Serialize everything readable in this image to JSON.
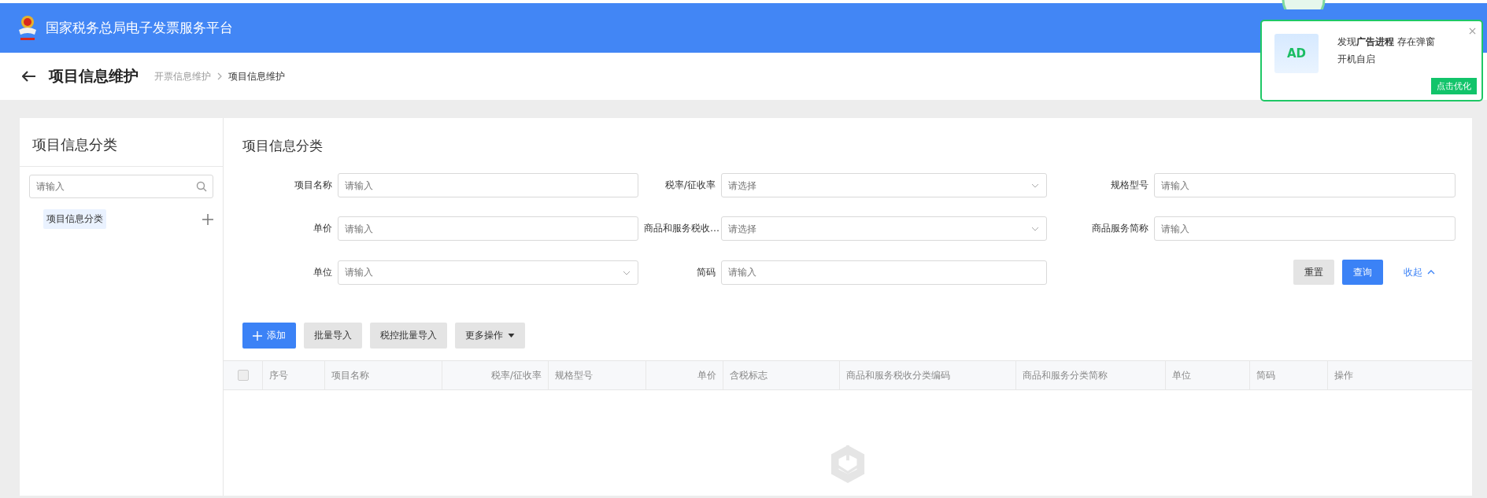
{
  "header": {
    "title": "国家税务总局电子发票服务平台"
  },
  "page": {
    "title": "项目信息维护",
    "breadcrumb": [
      {
        "label": "开票信息维护",
        "current": false
      },
      {
        "label": "项目信息维护",
        "current": true
      }
    ]
  },
  "sidebar": {
    "title": "项目信息分类",
    "search": {
      "placeholder": "请输入"
    },
    "tree": [
      {
        "label": "项目信息分类",
        "selected": true
      }
    ]
  },
  "main": {
    "title": "项目信息分类",
    "filters": [
      {
        "label": "项目名称",
        "placeholder": "请输入",
        "kind": "input"
      },
      {
        "label": "税率/征收率",
        "placeholder": "请选择",
        "kind": "select"
      },
      {
        "label": "规格型号",
        "placeholder": "请输入",
        "kind": "input"
      },
      {
        "label": "单价",
        "placeholder": "请输入",
        "kind": "input"
      },
      {
        "label": "商品和服务税收…",
        "placeholder": "请选择",
        "kind": "select"
      },
      {
        "label": "商品服务简称",
        "placeholder": "请输入",
        "kind": "input"
      },
      {
        "label": "单位",
        "placeholder": "请输入",
        "kind": "select"
      },
      {
        "label": "简码",
        "placeholder": "请输入",
        "kind": "input"
      }
    ],
    "reset": "重置",
    "query": "查询",
    "collapse": "收起",
    "toolbar": [
      {
        "label": "添加",
        "kind": "primary"
      },
      {
        "label": "批量导入",
        "kind": "default"
      },
      {
        "label": "税控批量导入",
        "kind": "default"
      },
      {
        "label": "更多操作",
        "kind": "dropdown"
      }
    ],
    "table": {
      "columns": [
        {
          "label": "序号",
          "numeric": false
        },
        {
          "label": "项目名称",
          "numeric": false
        },
        {
          "label": "税率/征收率",
          "numeric": true
        },
        {
          "label": "规格型号",
          "numeric": false
        },
        {
          "label": "单价",
          "numeric": true
        },
        {
          "label": "含税标志",
          "numeric": false
        },
        {
          "label": "商品和服务税收分类编码",
          "numeric": false
        },
        {
          "label": "商品和服务分类简称",
          "numeric": false
        },
        {
          "label": "单位",
          "numeric": false
        },
        {
          "label": "简码",
          "numeric": false
        },
        {
          "label": "操作",
          "numeric": false
        }
      ],
      "all_checked": false
    }
  },
  "popup": {
    "badge": "AD",
    "message": "发现**广告进程** 存在弹窗",
    "message_2": "开机自启",
    "button": "点击优化"
  }
}
